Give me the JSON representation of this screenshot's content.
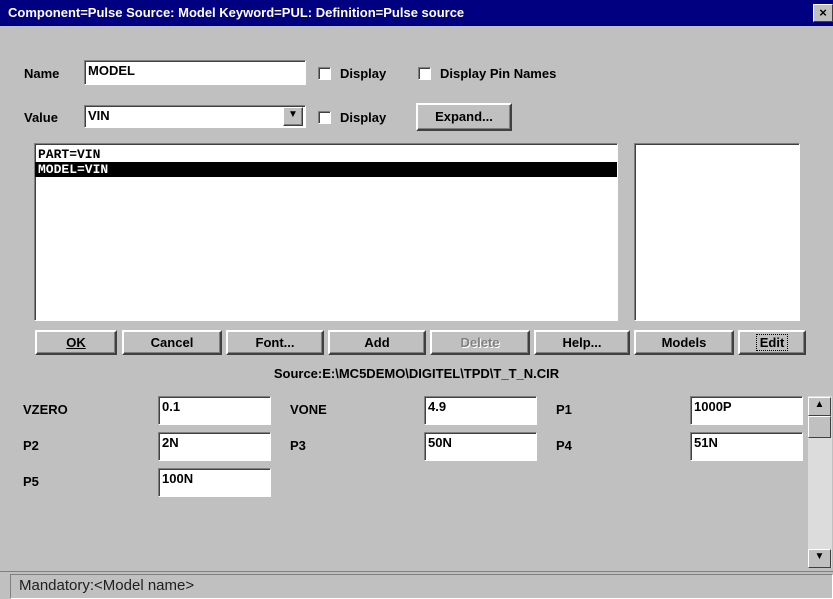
{
  "window": {
    "title": "Component=Pulse Source: Model Keyword=PUL: Definition=Pulse source",
    "close_glyph": "×"
  },
  "name_row": {
    "label": "Name",
    "value": "MODEL",
    "display_label": "Display",
    "display_checked": false,
    "pin_names_label": "Display Pin Names",
    "pin_names_checked": false
  },
  "value_row": {
    "label": "Value",
    "value": "VIN",
    "dropdown_glyph": "▼",
    "display_label": "Display",
    "display_checked": false,
    "expand_label": "Expand..."
  },
  "attributes_list": {
    "items": [
      "PART=VIN",
      "MODEL=VIN"
    ],
    "selected_index": 1
  },
  "buttons": {
    "ok": "OK",
    "cancel": "Cancel",
    "font": "Font...",
    "add": "Add",
    "delete": "Delete",
    "help": "Help...",
    "models": "Models",
    "edit": "Edit"
  },
  "source": "Source:E:\\MC5DEMO\\DIGITEL\\TPD\\T_T_N.CIR",
  "params": [
    {
      "name": "VZERO",
      "value": "0.1"
    },
    {
      "name": "VONE",
      "value": "4.9"
    },
    {
      "name": "P1",
      "value": "1000P"
    },
    {
      "name": "P2",
      "value": "2N"
    },
    {
      "name": "P3",
      "value": "50N"
    },
    {
      "name": "P4",
      "value": "51N"
    },
    {
      "name": "P5",
      "value": "100N"
    }
  ],
  "scrollbar": {
    "up_glyph": "▲",
    "down_glyph": "▼"
  },
  "status": "Mandatory:<Model name>"
}
